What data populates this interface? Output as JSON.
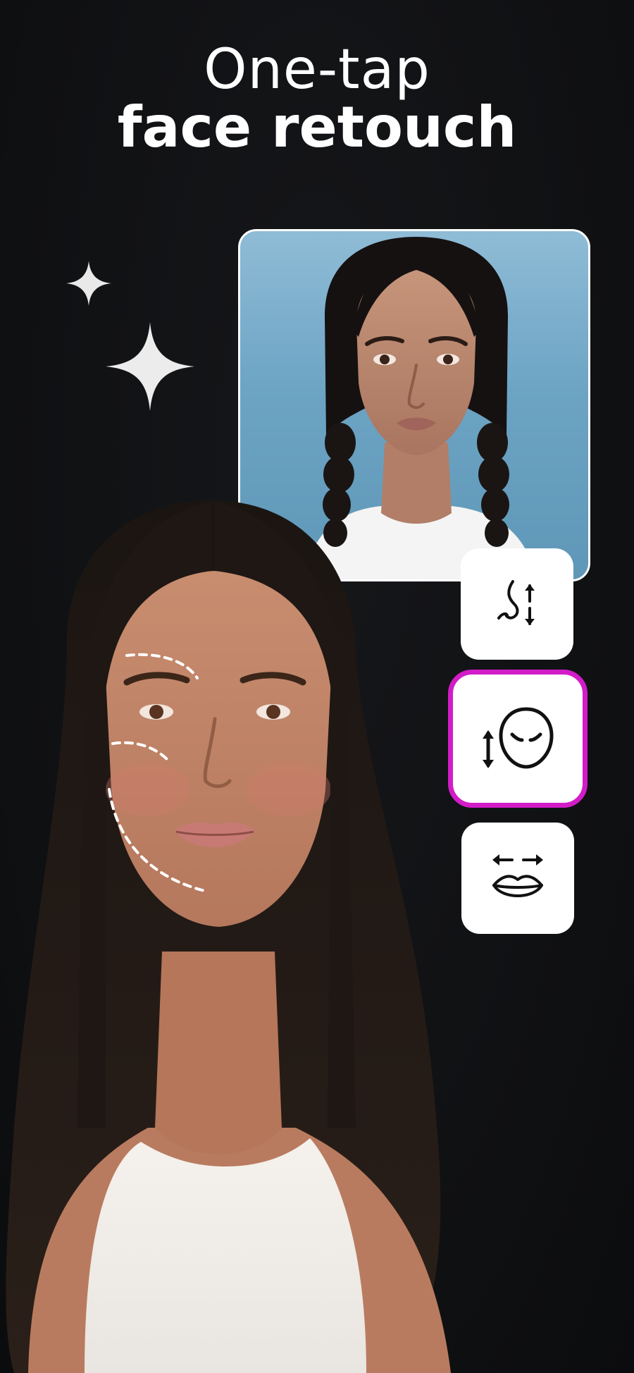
{
  "headline": {
    "line1": "One-tap",
    "line2": "face retouch"
  },
  "decor": {
    "sparkles": [
      "sparkle-icon",
      "sparkle-icon"
    ]
  },
  "images": {
    "reference_photo": "reference-portrait-image",
    "main_portrait": "retouched-portrait-image"
  },
  "tools": [
    {
      "icon": "nose-reshape-icon",
      "selected": false
    },
    {
      "icon": "face-reshape-icon",
      "selected": true
    },
    {
      "icon": "lips-reshape-icon",
      "selected": false
    }
  ],
  "colors": {
    "background": "#111214",
    "selected_border": "#d21cc8",
    "text": "#ffffff"
  }
}
